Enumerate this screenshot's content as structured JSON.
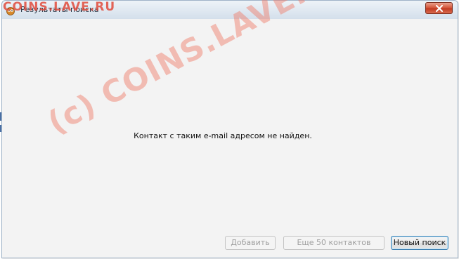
{
  "window": {
    "title": "Результаты поиска",
    "app_icon": "owl-icon",
    "close_icon": "close-icon"
  },
  "content": {
    "message": "Контакт с таким e-mail адресом не найден."
  },
  "buttons": {
    "add": {
      "label": "Добавить",
      "enabled": false
    },
    "more_contacts": {
      "label": "Еще 50 контактов",
      "enabled": false
    },
    "new_search": {
      "label": "Новый поиск",
      "enabled": true
    }
  },
  "watermarks": {
    "top": "COINS.LAVE.RU",
    "diagonal": "(c) COINS.LAVE.RU"
  },
  "colors": {
    "close_button": "#c23b22",
    "watermark": "#e14b3c",
    "default_button_border": "#3c7fb1"
  }
}
